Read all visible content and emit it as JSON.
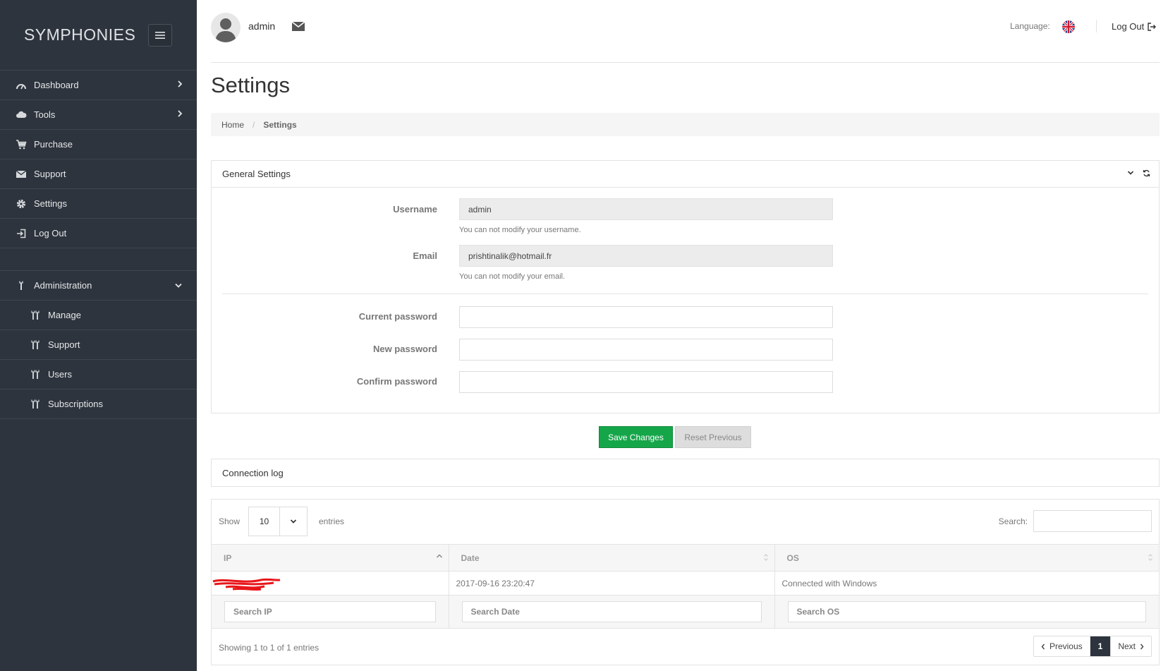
{
  "sidebar": {
    "brand": "SYMPHONIES",
    "items": [
      {
        "label": "Dashboard"
      },
      {
        "label": "Tools"
      },
      {
        "label": "Purchase"
      },
      {
        "label": "Support"
      },
      {
        "label": "Settings"
      },
      {
        "label": "Log Out"
      },
      {
        "label": "Administration"
      }
    ],
    "subitems": [
      {
        "label": "Manage"
      },
      {
        "label": "Support"
      },
      {
        "label": "Users"
      },
      {
        "label": "Subscriptions"
      }
    ]
  },
  "header": {
    "username": "admin",
    "language_label": "Language:",
    "logout_label": "Log Out"
  },
  "page": {
    "title": "Settings",
    "breadcrumb": {
      "home": "Home",
      "separator": "/",
      "current": "Settings"
    }
  },
  "general": {
    "title": "General Settings",
    "username_label": "Username",
    "username_value": "admin",
    "username_help": "You can not modify your username.",
    "email_label": "Email",
    "email_value": "prishtinalik@hotmail.fr",
    "email_help": "You can not modify your email.",
    "current_password_label": "Current password",
    "new_password_label": "New password",
    "confirm_password_label": "Confirm password"
  },
  "actions": {
    "save_label": "Save Changes",
    "reset_label": "Reset Previous"
  },
  "connection_log": {
    "title": "Connection log",
    "show_label": "Show",
    "page_length": "10",
    "entries_label": "entries",
    "search_label": "Search:",
    "columns": [
      "IP",
      "Date",
      "OS"
    ],
    "rows": [
      {
        "ip": "",
        "date": "2017-09-16 23:20:47",
        "os": "Connected with Windows"
      }
    ],
    "filters": [
      "Search IP",
      "Search Date",
      "Search OS"
    ],
    "info": "Showing 1 to 1 of 1 entries",
    "pagination": {
      "previous": "Previous",
      "current_page": "1",
      "next": "Next"
    }
  },
  "colors": {
    "sidebar_bg": "#2d343d",
    "save_button": "#16a64a",
    "active_page": "#2d343d",
    "redaction": "#e8161b"
  }
}
